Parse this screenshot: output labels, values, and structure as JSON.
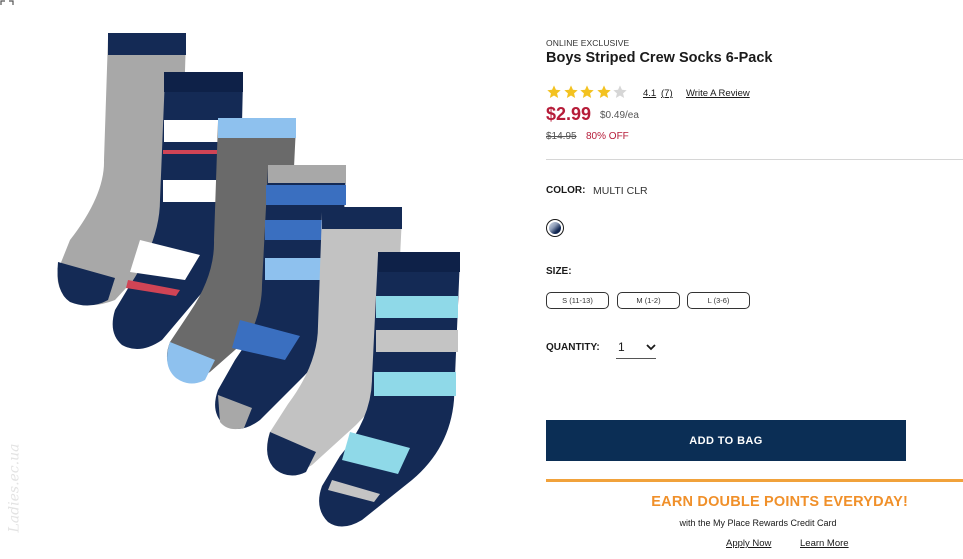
{
  "product": {
    "eyebrow": "ONLINE EXCLUSIVE",
    "title": "Boys Striped Crew Socks 6-Pack",
    "rating": 4.1,
    "rating_label": "4.1",
    "review_count_label": "(7)",
    "write_review_label": "Write A Review",
    "price": "$2.99",
    "unit_price": "$0.49/ea",
    "original_price": "$14.95",
    "discount": "80% OFF"
  },
  "color": {
    "label": "COLOR:",
    "value": "MULTI CLR"
  },
  "size": {
    "label": "SIZE:",
    "options": [
      "S (11-13)",
      "M (1-2)",
      "L (3-6)"
    ]
  },
  "quantity": {
    "label": "QUANTITY:",
    "value": "1"
  },
  "cta": {
    "add_to_bag": "ADD TO BAG"
  },
  "promo": {
    "title": "EARN DOUBLE POINTS EVERYDAY!",
    "subtitle": "with the My Place Rewards Credit Card",
    "apply_label": "Apply Now",
    "learn_label": "Learn More"
  },
  "image": {
    "watermark": "Ladies.ec.ua"
  },
  "icons": {
    "star": "star-icon",
    "expand": "expand-icon",
    "chevron": "chevron-down-icon"
  },
  "colors": {
    "price_red": "#b61c39",
    "navy": "#0b2e55",
    "promo_orange": "#f0902a",
    "star_gold": "#f3c220"
  }
}
